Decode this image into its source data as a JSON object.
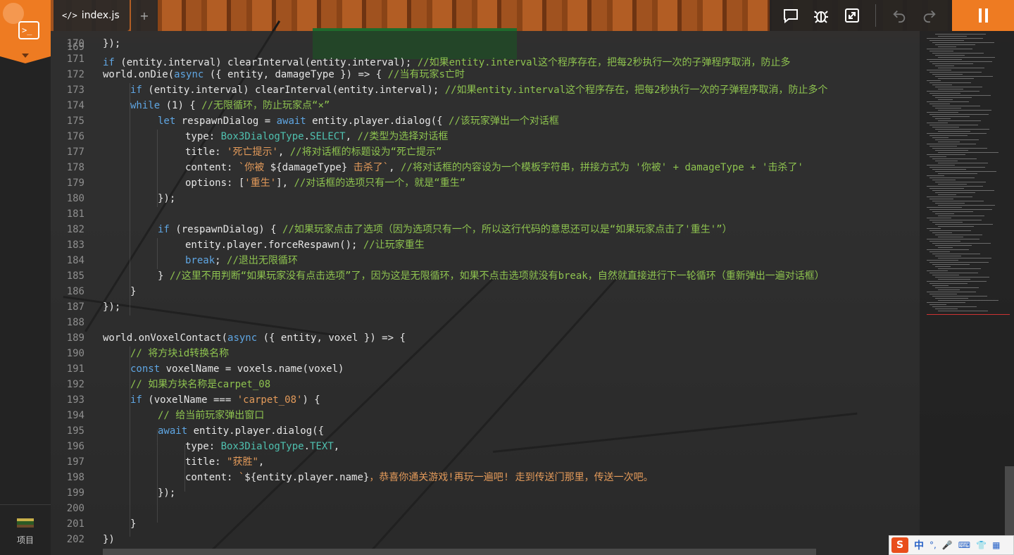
{
  "tabs": {
    "active_label": "index.js",
    "add_label": "+"
  },
  "sidebar": {
    "project_label": "项目"
  },
  "toolbar": {
    "icons": [
      "comment-icon",
      "bug-icon",
      "expand-icon",
      "undo-icon",
      "redo-icon"
    ],
    "pause": "pause-icon"
  },
  "ime": {
    "logo": "S",
    "lang": "中",
    "items": [
      "°,",
      "🎤",
      "⌨",
      "👕",
      "▦"
    ]
  },
  "colors": {
    "accent": "#ee7b22",
    "keyword": "#5fa6e3",
    "comment": "#8ec34f",
    "string": "#e39a5a",
    "type": "#4fc1b0"
  },
  "code": {
    "lines": [
      {
        "n": "170",
        "indent": 0,
        "tokens": [
          [
            "p",
            "});"
          ]
        ]
      },
      {
        "n": "171",
        "indent": 0,
        "tokens": []
      },
      {
        "n": "172",
        "indent": 0,
        "tokens": [
          [
            "p",
            "world.onDie("
          ],
          [
            "kw",
            "async"
          ],
          [
            "p",
            " ({ entity, damageType }) => { "
          ],
          [
            "cm",
            "//当有玩家s亡时"
          ]
        ]
      },
      {
        "n": "173",
        "indent": 1,
        "tokens": [
          [
            "kw",
            "if"
          ],
          [
            "p",
            " (entity.interval) clearInterval(entity.interval); "
          ],
          [
            "cm",
            "//如果entity.interval这个程序存在，把每2秒执行一次的子弹程序取消，防止多个"
          ]
        ]
      },
      {
        "n": "174",
        "indent": 1,
        "tokens": [
          [
            "kw",
            "while"
          ],
          [
            "p",
            " (1) { "
          ],
          [
            "cm",
            "//无限循环，防止玩家点“×”"
          ]
        ]
      },
      {
        "n": "175",
        "indent": 2,
        "tokens": [
          [
            "kw",
            "let"
          ],
          [
            "p",
            " respawnDialog = "
          ],
          [
            "kw",
            "await"
          ],
          [
            "p",
            " entity.player.dialog({ "
          ],
          [
            "cm",
            "//该玩家弹出一个对话框"
          ]
        ]
      },
      {
        "n": "176",
        "indent": 3,
        "tokens": [
          [
            "p",
            "type: "
          ],
          [
            "ty",
            "Box3DialogType"
          ],
          [
            "p",
            "."
          ],
          [
            "ty",
            "SELECT"
          ],
          [
            "p",
            ", "
          ],
          [
            "cm",
            "//类型为选择对话框"
          ]
        ]
      },
      {
        "n": "177",
        "indent": 3,
        "tokens": [
          [
            "p",
            "title: "
          ],
          [
            "st",
            "'死亡提示'"
          ],
          [
            "p",
            ", "
          ],
          [
            "cm",
            "//将对话框的标题设为“死亡提示”"
          ]
        ]
      },
      {
        "n": "178",
        "indent": 3,
        "tokens": [
          [
            "p",
            "content: "
          ],
          [
            "st",
            "`你被 "
          ],
          [
            "p",
            "${damageType}"
          ],
          [
            "st",
            " 击杀了`"
          ],
          [
            "p",
            ", "
          ],
          [
            "cm",
            "//将对话框的内容设为一个模板字符串，拼接方式为 '你被' + damageType + '击杀了'"
          ]
        ]
      },
      {
        "n": "179",
        "indent": 3,
        "tokens": [
          [
            "p",
            "options: ["
          ],
          [
            "st",
            "'重生'"
          ],
          [
            "p",
            "], "
          ],
          [
            "cm",
            "//对话框的选项只有一个，就是“重生”"
          ]
        ]
      },
      {
        "n": "180",
        "indent": 2,
        "tokens": [
          [
            "p",
            "});"
          ]
        ]
      },
      {
        "n": "181",
        "indent": 0,
        "tokens": []
      },
      {
        "n": "182",
        "indent": 2,
        "tokens": [
          [
            "kw",
            "if"
          ],
          [
            "p",
            " (respawnDialog) { "
          ],
          [
            "cm",
            "//如果玩家点击了选项（因为选项只有一个，所以这行代码的意思还可以是“如果玩家点击了'重生'”）"
          ]
        ]
      },
      {
        "n": "183",
        "indent": 3,
        "tokens": [
          [
            "p",
            "entity.player.forceRespawn(); "
          ],
          [
            "cm",
            "//让玩家重生"
          ]
        ]
      },
      {
        "n": "184",
        "indent": 3,
        "tokens": [
          [
            "kw",
            "break"
          ],
          [
            "p",
            "; "
          ],
          [
            "cm",
            "//退出无限循环"
          ]
        ]
      },
      {
        "n": "185",
        "indent": 2,
        "tokens": [
          [
            "p",
            "} "
          ],
          [
            "cm",
            "//这里不用判断“如果玩家没有点击选项”了，因为这是无限循环，如果不点击选项就没有break，自然就直接进行下一轮循环（重新弹出一遍对话框）"
          ]
        ]
      },
      {
        "n": "186",
        "indent": 1,
        "tokens": [
          [
            "p",
            "}"
          ]
        ]
      },
      {
        "n": "187",
        "indent": 0,
        "tokens": [
          [
            "p",
            "});"
          ]
        ]
      },
      {
        "n": "188",
        "indent": 0,
        "tokens": []
      },
      {
        "n": "189",
        "indent": 0,
        "tokens": [
          [
            "p",
            "world.onVoxelContact("
          ],
          [
            "kw",
            "async"
          ],
          [
            "p",
            " ({ entity, voxel }) => {"
          ]
        ]
      },
      {
        "n": "190",
        "indent": 1,
        "tokens": [
          [
            "cm",
            "// 将方块id转换名称"
          ]
        ]
      },
      {
        "n": "191",
        "indent": 1,
        "tokens": [
          [
            "kw",
            "const"
          ],
          [
            "p",
            " voxelName = voxels.name(voxel)"
          ]
        ]
      },
      {
        "n": "192",
        "indent": 1,
        "tokens": [
          [
            "cm",
            "// 如果方块名称是carpet_08"
          ]
        ]
      },
      {
        "n": "193",
        "indent": 1,
        "tokens": [
          [
            "kw",
            "if"
          ],
          [
            "p",
            " (voxelName === "
          ],
          [
            "st",
            "'carpet_08'"
          ],
          [
            "p",
            ") {"
          ]
        ]
      },
      {
        "n": "194",
        "indent": 2,
        "tokens": [
          [
            "cm",
            "// 给当前玩家弹出窗口"
          ]
        ]
      },
      {
        "n": "195",
        "indent": 2,
        "tokens": [
          [
            "kw",
            "await"
          ],
          [
            "p",
            " entity.player.dialog({"
          ]
        ]
      },
      {
        "n": "196",
        "indent": 3,
        "tokens": [
          [
            "p",
            "type: "
          ],
          [
            "ty",
            "Box3DialogType"
          ],
          [
            "p",
            "."
          ],
          [
            "ty",
            "TEXT"
          ],
          [
            "p",
            ","
          ]
        ]
      },
      {
        "n": "197",
        "indent": 3,
        "tokens": [
          [
            "p",
            "title: "
          ],
          [
            "st",
            "\"获胜\""
          ],
          [
            "p",
            ","
          ]
        ]
      },
      {
        "n": "198",
        "indent": 3,
        "tokens": [
          [
            "p",
            "content: "
          ],
          [
            "st",
            "`"
          ],
          [
            "p",
            "${entity.player.name}"
          ],
          [
            "st",
            "，恭喜你通关游戏!再玩一遍吧! 走到传送门那里，传送一次吧。"
          ]
        ]
      },
      {
        "n": "199",
        "indent": 2,
        "tokens": [
          [
            "p",
            "});"
          ]
        ]
      },
      {
        "n": "200",
        "indent": 0,
        "tokens": []
      },
      {
        "n": "201",
        "indent": 1,
        "tokens": [
          [
            "p",
            "}"
          ]
        ]
      },
      {
        "n": "202",
        "indent": 0,
        "tokens": [
          [
            "p",
            "})"
          ]
        ]
      }
    ]
  }
}
